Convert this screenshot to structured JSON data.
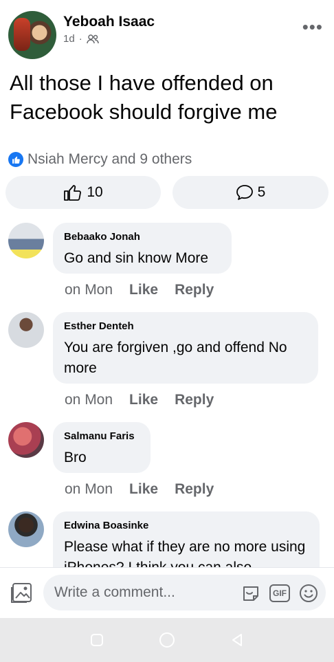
{
  "post": {
    "author": "Yeboah Isaac",
    "time": "1d",
    "separator": "·",
    "audience_icon": "friends-icon",
    "more_icon": "more-options-icon",
    "more_label": "•••",
    "text": "All those I have offended on Facebook should forgive me",
    "reaction_summary": "Nsiah Mercy and 9 others",
    "like_count": "10",
    "comment_count": "5"
  },
  "comments": [
    {
      "name": "Bebaako Jonah",
      "text": "Go and sin know More",
      "time": "on Mon",
      "like": "Like",
      "reply": "Reply"
    },
    {
      "name": "Esther Denteh",
      "text": "You are forgiven ,go and offend No more",
      "time": "on Mon",
      "like": "Like",
      "reply": "Reply"
    },
    {
      "name": "Salmanu Faris",
      "text": "Bro",
      "time": "on Mon",
      "like": "Like",
      "reply": "Reply"
    },
    {
      "name": "Edwina Boasinke",
      "text": "Please what if they are no more using iPhones? I think you can also",
      "time": "",
      "like": "",
      "reply": ""
    }
  ],
  "composer": {
    "placeholder": "Write a comment...",
    "gif_label": "GIF"
  },
  "colors": {
    "accent": "#1877f2",
    "bubble": "#f0f2f5",
    "secondary_text": "#65676b"
  }
}
